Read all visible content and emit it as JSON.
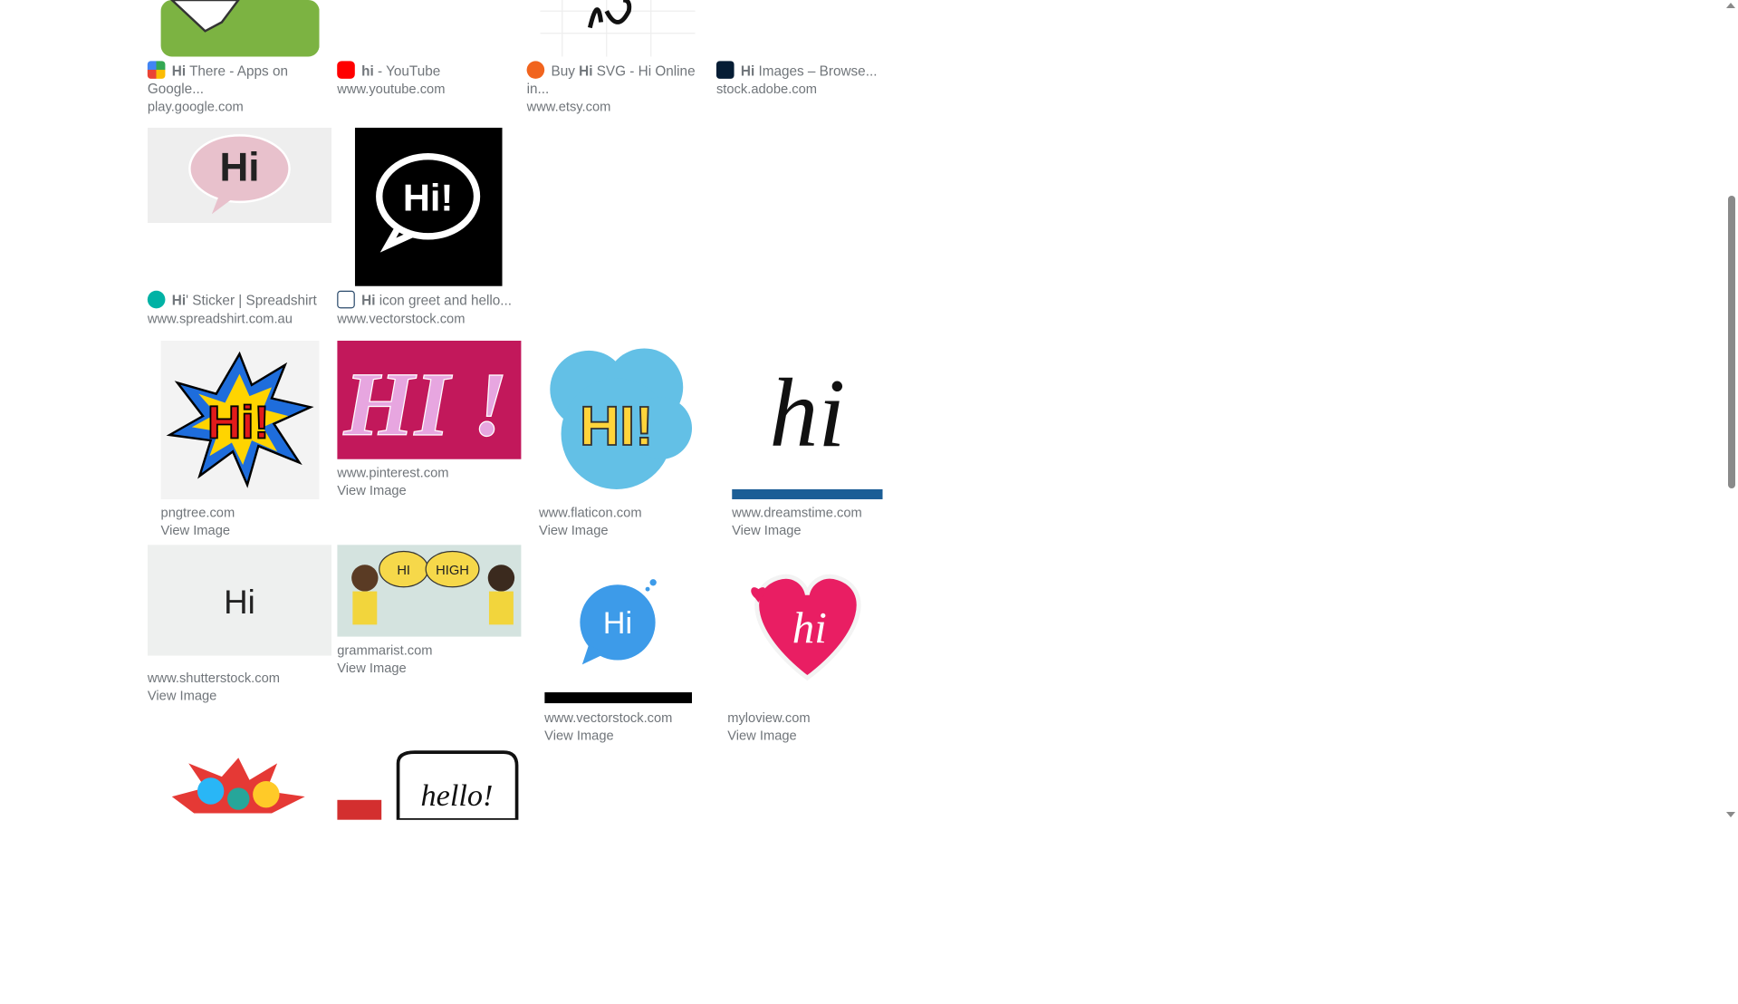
{
  "row1": [
    {
      "title_pre": "",
      "bold": "Hi",
      "title_post": " There - Apps on Google...",
      "url": "play.google.com"
    },
    {
      "title_pre": "",
      "bold": "hi",
      "title_post": " - YouTube",
      "url": "www.youtube.com"
    },
    {
      "title_pre": "Buy ",
      "bold": "Hi",
      "title_post": " SVG - Hi Online in...",
      "url": "www.etsy.com"
    },
    {
      "title_pre": "",
      "bold": "Hi",
      "title_post": " Images – Browse...",
      "url": "stock.adobe.com"
    }
  ],
  "row2": [
    {
      "title_pre": "",
      "bold": "Hi",
      "title_post": "' Sticker | Spreadshirt",
      "url": "www.spreadshirt.com.au"
    },
    {
      "title_pre": "",
      "bold": "Hi",
      "title_post": " icon greet and hello...",
      "url": "www.vectorstock.com"
    }
  ],
  "row3": [
    {
      "url": "pngtree.com",
      "view": "View Image"
    },
    {
      "url": "www.pinterest.com",
      "view": "View Image"
    },
    {
      "url": "www.flaticon.com",
      "view": "View Image"
    },
    {
      "url": "www.dreamstime.com",
      "view": "View Image"
    }
  ],
  "row4": [
    {
      "url": "www.shutterstock.com",
      "view": "View Image"
    },
    {
      "url": "grammarist.com",
      "view": "View Image"
    },
    {
      "url": "www.vectorstock.com",
      "view": "View Image"
    },
    {
      "url": "myloview.com",
      "view": "View Image"
    }
  ],
  "image_text": {
    "hi_speech_pink": "Hi",
    "hi_bubble_black": "Hi!",
    "hi_comic": "Hi!",
    "hi_glitter": "HI !",
    "hi_flaticon": "HI!",
    "hi_script": "hi",
    "hi_shutter": "Hi",
    "hi_bubble_left": "HI",
    "hi_bubble_right": "HIGH",
    "hi_blue": "Hi",
    "hi_heart": "hi",
    "hello": "hello!"
  }
}
